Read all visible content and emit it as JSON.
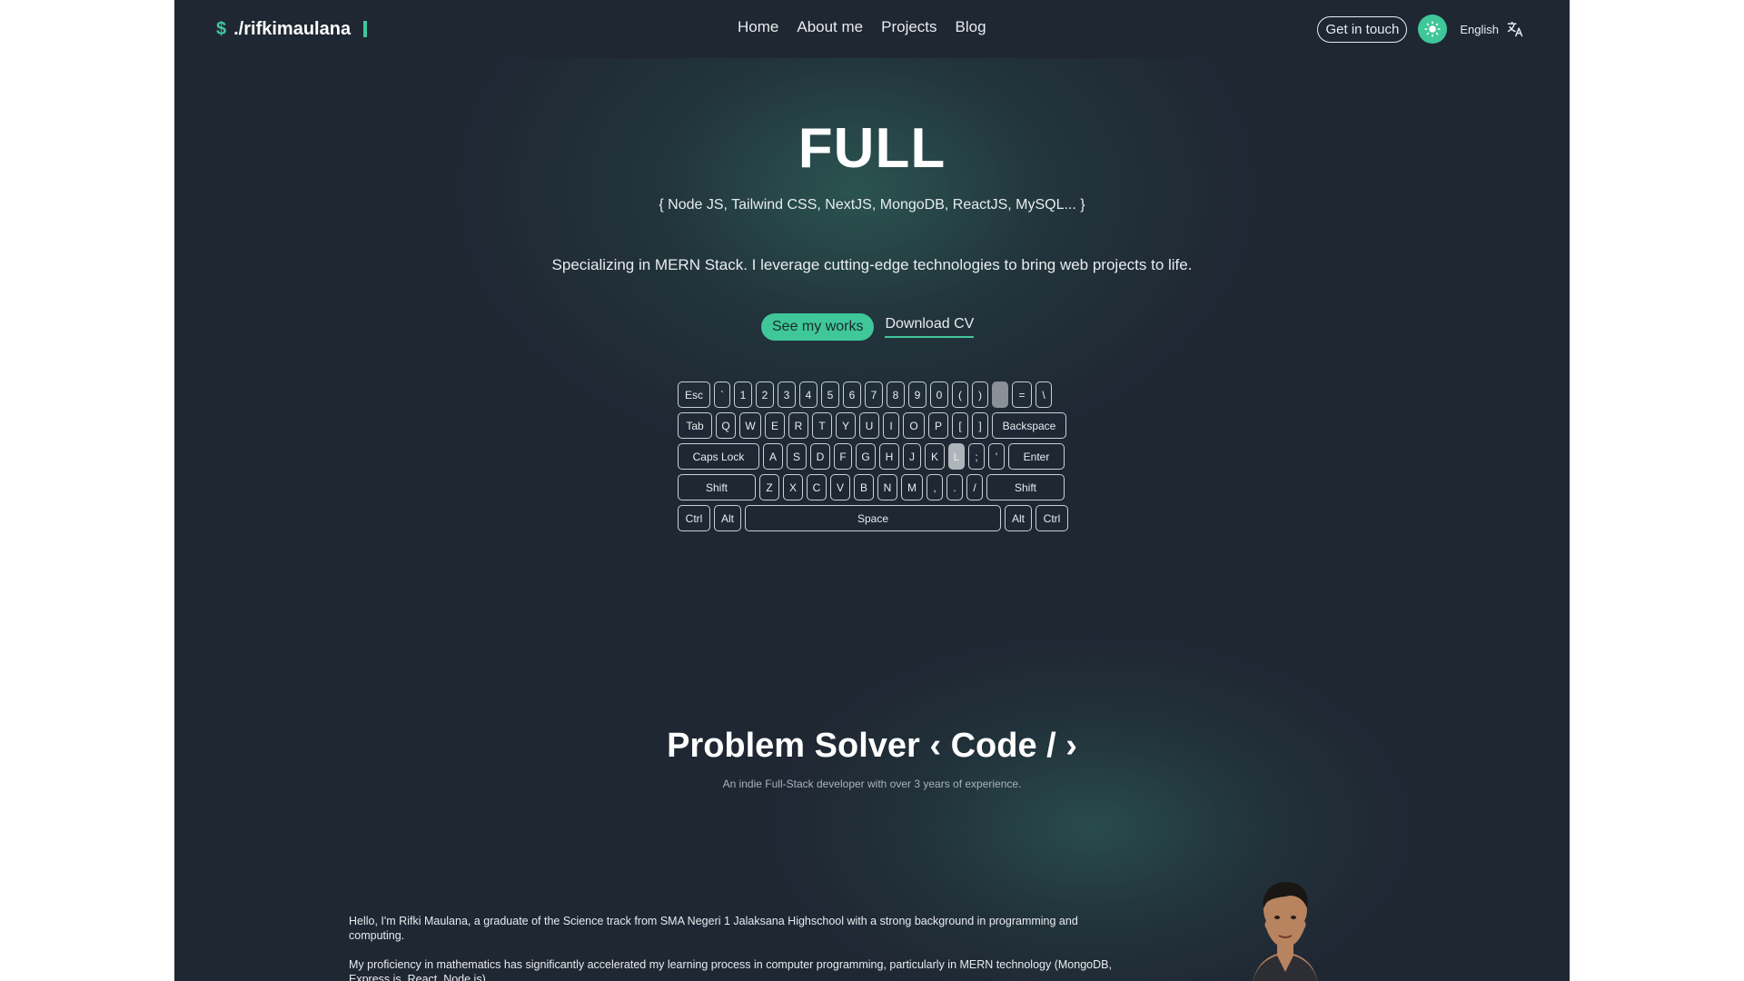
{
  "nav": {
    "logo_symbol": "$",
    "logo_text": "./rifkimaulana",
    "links": [
      "Home",
      "About me",
      "Projects",
      "Blog"
    ],
    "get_in_touch": "Get in touch",
    "language": "English"
  },
  "hero": {
    "title": "FULL",
    "stack": "{ Node JS, Tailwind CSS, NextJS, MongoDB, ReactJS, MySQL... }",
    "description": "Specializing in MERN Stack. I leverage cutting-edge technologies to bring web projects to life.",
    "primary_button": "See my works",
    "secondary_link": "Download CV"
  },
  "keyboard": {
    "row1": [
      "Esc",
      "`",
      "1",
      "2",
      "3",
      "4",
      "5",
      "6",
      "7",
      "8",
      "9",
      "0",
      "(",
      ")",
      "-",
      "=",
      "\\"
    ],
    "row2": [
      "Tab",
      "Q",
      "W",
      "E",
      "R",
      "T",
      "Y",
      "U",
      "I",
      "O",
      "P",
      "[",
      "]",
      "Backspace"
    ],
    "row3": [
      "Caps Lock",
      "A",
      "S",
      "D",
      "F",
      "G",
      "H",
      "J",
      "K",
      "L",
      ";",
      "'",
      "Enter"
    ],
    "row4": [
      "Shift",
      "Z",
      "X",
      "C",
      "V",
      "B",
      "N",
      "M",
      ",",
      ".",
      "/",
      "Shift"
    ],
    "row5": [
      "Ctrl",
      "Alt",
      "Space",
      "Alt",
      "Ctrl"
    ]
  },
  "solver": {
    "title": "Problem Solver ‹ Code / ›",
    "subtitle": "An indie Full-Stack developer with over 3 years of experience."
  },
  "about": {
    "para1": "Hello, I'm Rifki Maulana, a graduate of the Science track from SMA Negeri 1 Jalaksana Highschool with a strong background in programming and computing.",
    "para2": "My proficiency in mathematics has significantly accelerated my learning process in computer programming, particularly in MERN technology (MongoDB, Express.js, React, Node.js)."
  },
  "colors": {
    "background": "#1f2733",
    "accent": "#3fc79a",
    "text": "#e8ecef"
  },
  "icons": {
    "theme": "sun-icon",
    "language": "translate-icon"
  }
}
